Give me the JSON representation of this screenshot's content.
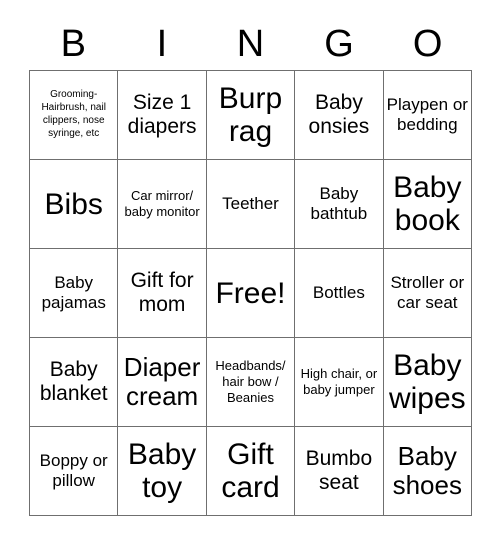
{
  "card": {
    "header_letters": [
      "B",
      "I",
      "N",
      "G",
      "O"
    ],
    "border_color": "#6f6f6f",
    "text_color": "#000000",
    "background_color": "#ffffff",
    "columns": 5,
    "rows": 5,
    "cells": [
      {
        "text": "Grooming-\nHairbrush, nail clippers, nose syringe, etc",
        "size": "fs-xs",
        "free": false
      },
      {
        "text": "Size 1 diapers",
        "size": "fs-lg",
        "free": false
      },
      {
        "text": "Burp rag",
        "size": "fs-xxl",
        "free": false
      },
      {
        "text": "Baby onsies",
        "size": "fs-lg",
        "free": false
      },
      {
        "text": "Playpen or bedding",
        "size": "fs-md",
        "free": false
      },
      {
        "text": "Bibs",
        "size": "fs-xxl",
        "free": false
      },
      {
        "text": "Car mirror/ baby monitor",
        "size": "fs-sm",
        "free": false
      },
      {
        "text": "Teether",
        "size": "fs-md",
        "free": false
      },
      {
        "text": "Baby bathtub",
        "size": "fs-md",
        "free": false
      },
      {
        "text": "Baby book",
        "size": "fs-xxl",
        "free": false
      },
      {
        "text": "Baby pajamas",
        "size": "fs-md",
        "free": false
      },
      {
        "text": "Gift for mom",
        "size": "fs-lg",
        "free": false
      },
      {
        "text": "Free!",
        "size": "fs-xxl",
        "free": true
      },
      {
        "text": "Bottles",
        "size": "fs-md",
        "free": false
      },
      {
        "text": "Stroller or car seat",
        "size": "fs-md",
        "free": false
      },
      {
        "text": "Baby blanket",
        "size": "fs-lg",
        "free": false
      },
      {
        "text": "Diaper cream",
        "size": "fs-xl",
        "free": false
      },
      {
        "text": "Headbands/ hair bow / Beanies",
        "size": "fs-sm",
        "free": false
      },
      {
        "text": "High chair, or baby jumper",
        "size": "fs-sm",
        "free": false
      },
      {
        "text": "Baby wipes",
        "size": "fs-xxl",
        "free": false
      },
      {
        "text": "Boppy or pillow",
        "size": "fs-md",
        "free": false
      },
      {
        "text": "Baby toy",
        "size": "fs-xxl",
        "free": false
      },
      {
        "text": "Gift card",
        "size": "fs-xxl",
        "free": false
      },
      {
        "text": "Bumbo seat",
        "size": "fs-lg",
        "free": false
      },
      {
        "text": "Baby shoes",
        "size": "fs-xl",
        "free": false
      }
    ]
  }
}
